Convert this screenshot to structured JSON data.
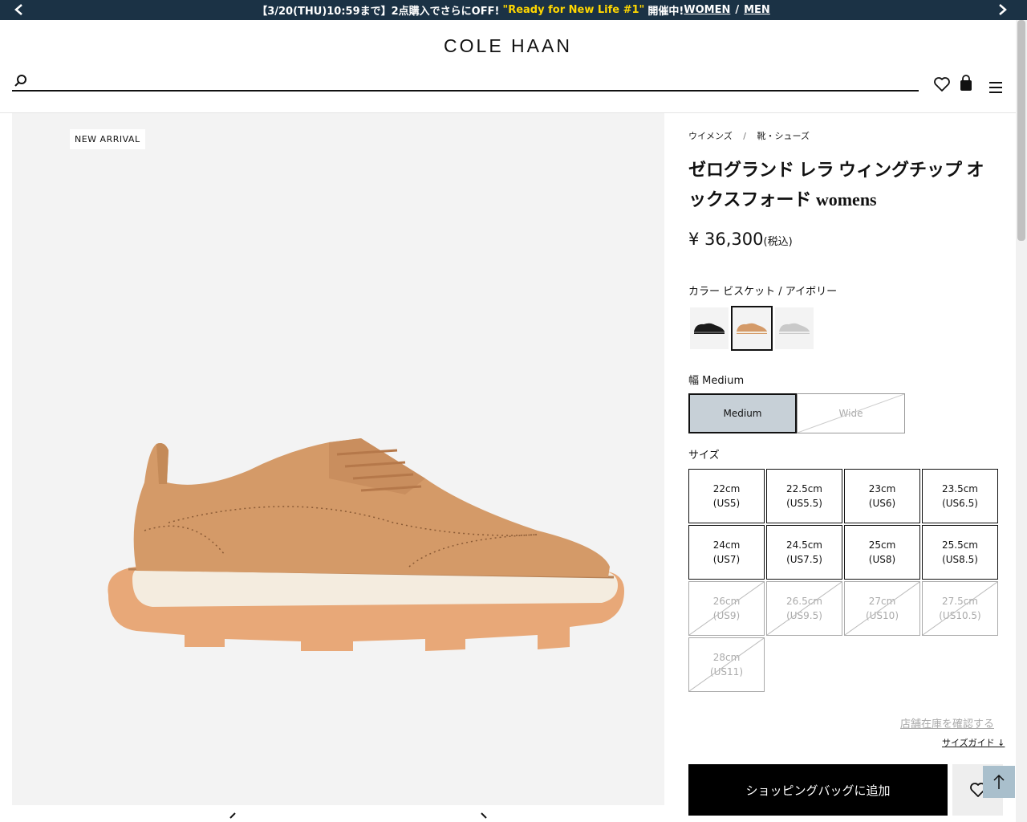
{
  "promo": {
    "text_before": "【3/20(THU)10:59まで】2点購入でさらにOFF!",
    "highlight": "\"Ready for New Life #1\"",
    "text_after": "開催中!",
    "link_women": "WOMEN",
    "separator": "/",
    "link_men": "MEN"
  },
  "header": {
    "logo": "COLE HAAN",
    "search_placeholder": ""
  },
  "gallery": {
    "badge": "NEW ARRIVAL"
  },
  "breadcrumb": {
    "items": [
      "ウイメンズ",
      "靴・シューズ"
    ],
    "separator": "/"
  },
  "product": {
    "title": "ゼログランド レラ ウィングチップ オックスフォード womens",
    "price": "¥ 36,300",
    "tax": "(税込)",
    "color_label": "カラー ビスケット / アイボリー",
    "width_label": "幅 Medium",
    "widths": [
      "Medium",
      "Wide"
    ],
    "size_label": "サイズ",
    "sizes": [
      {
        "cm": "22cm",
        "us": "(US5)"
      },
      {
        "cm": "22.5cm",
        "us": "(US5.5)"
      },
      {
        "cm": "23cm",
        "us": "(US6)"
      },
      {
        "cm": "23.5cm",
        "us": "(US6.5)"
      },
      {
        "cm": "24cm",
        "us": "(US7)"
      },
      {
        "cm": "24.5cm",
        "us": "(US7.5)"
      },
      {
        "cm": "25cm",
        "us": "(US8)"
      },
      {
        "cm": "25.5cm",
        "us": "(US8.5)"
      },
      {
        "cm": "26cm",
        "us": "(US9)"
      },
      {
        "cm": "26.5cm",
        "us": "(US9.5)"
      },
      {
        "cm": "27cm",
        "us": "(US10)"
      },
      {
        "cm": "27.5cm",
        "us": "(US10.5)"
      },
      {
        "cm": "28cm",
        "us": "(US11)"
      }
    ],
    "store_stock": "店舗在庫を確認する",
    "size_guide": "サイズガイド ↓",
    "add_to_bag": "ショッピングバッグに追加"
  },
  "colors": {
    "nav_bg": "#1b3245",
    "promo_highlight": "#ffd700",
    "selected_width": "#c7d0d7",
    "shoe": "#d49a68",
    "sole": "#f4ecdf"
  }
}
